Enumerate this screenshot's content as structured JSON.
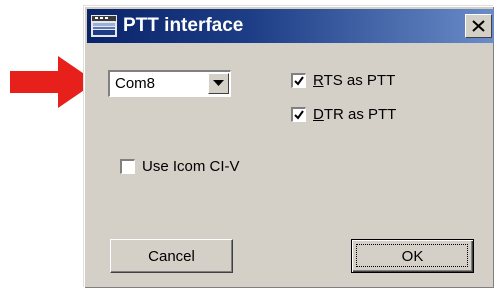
{
  "annotation": {
    "arrow_color": "#e8201c"
  },
  "window": {
    "title": "PTT interface",
    "title_icon": "app-icon",
    "close_icon": "close-icon"
  },
  "port_select": {
    "value": "Com8",
    "dropdown_icon": "chevron-down-icon"
  },
  "options": {
    "rts": {
      "label_accel": "R",
      "label_rest": "TS as PTT",
      "checked": true
    },
    "dtr": {
      "label_accel": "D",
      "label_rest": "TR as PTT",
      "checked": true
    },
    "icom": {
      "label": "Use Icom CI-V",
      "checked": false
    }
  },
  "buttons": {
    "cancel": "Cancel",
    "ok": "OK"
  }
}
